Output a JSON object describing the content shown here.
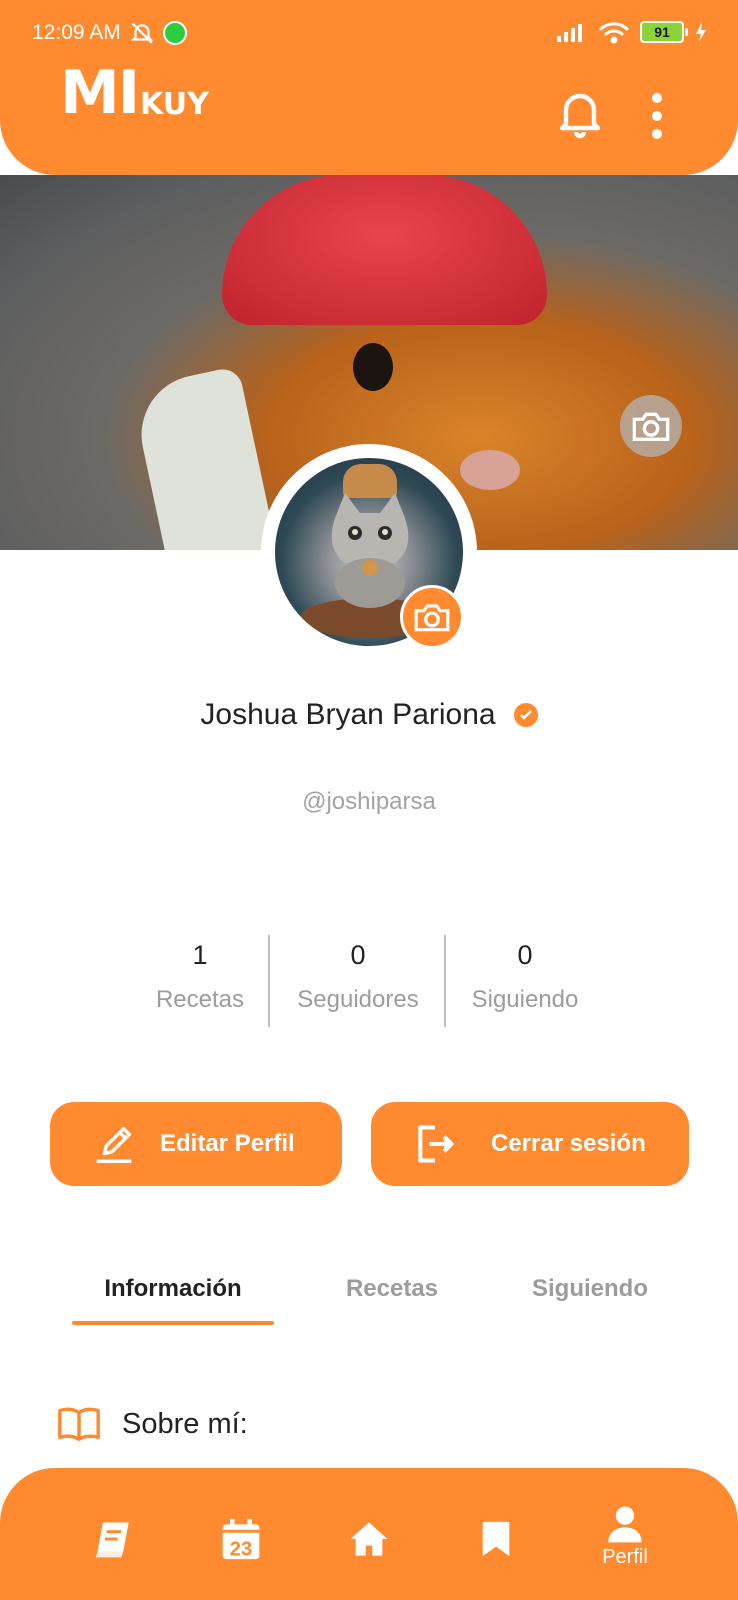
{
  "status_bar": {
    "time": "12:09 AM",
    "battery": "91"
  },
  "header": {
    "logo_big": "MI",
    "logo_small": "KUY"
  },
  "profile": {
    "name": "Joshua Bryan Pariona",
    "handle": "@joshiparsa"
  },
  "stats": [
    {
      "value": "1",
      "label": "Recetas"
    },
    {
      "value": "0",
      "label": "Seguidores"
    },
    {
      "value": "0",
      "label": "Siguiendo"
    }
  ],
  "buttons": {
    "edit": "Editar Perfil",
    "logout": "Cerrar sesión"
  },
  "tabs": [
    "Información",
    "Recetas",
    "Siguiendo"
  ],
  "active_tab": "Información",
  "section": {
    "about": "Sobre mí:"
  },
  "bottom_nav": {
    "items": [
      {
        "icon": "book-icon"
      },
      {
        "icon": "calendar-icon",
        "day": "23"
      },
      {
        "icon": "home-icon"
      },
      {
        "icon": "bookmark-icon"
      },
      {
        "icon": "user-icon",
        "label": "Perfil"
      }
    ]
  },
  "colors": {
    "accent": "#FF8A30"
  }
}
